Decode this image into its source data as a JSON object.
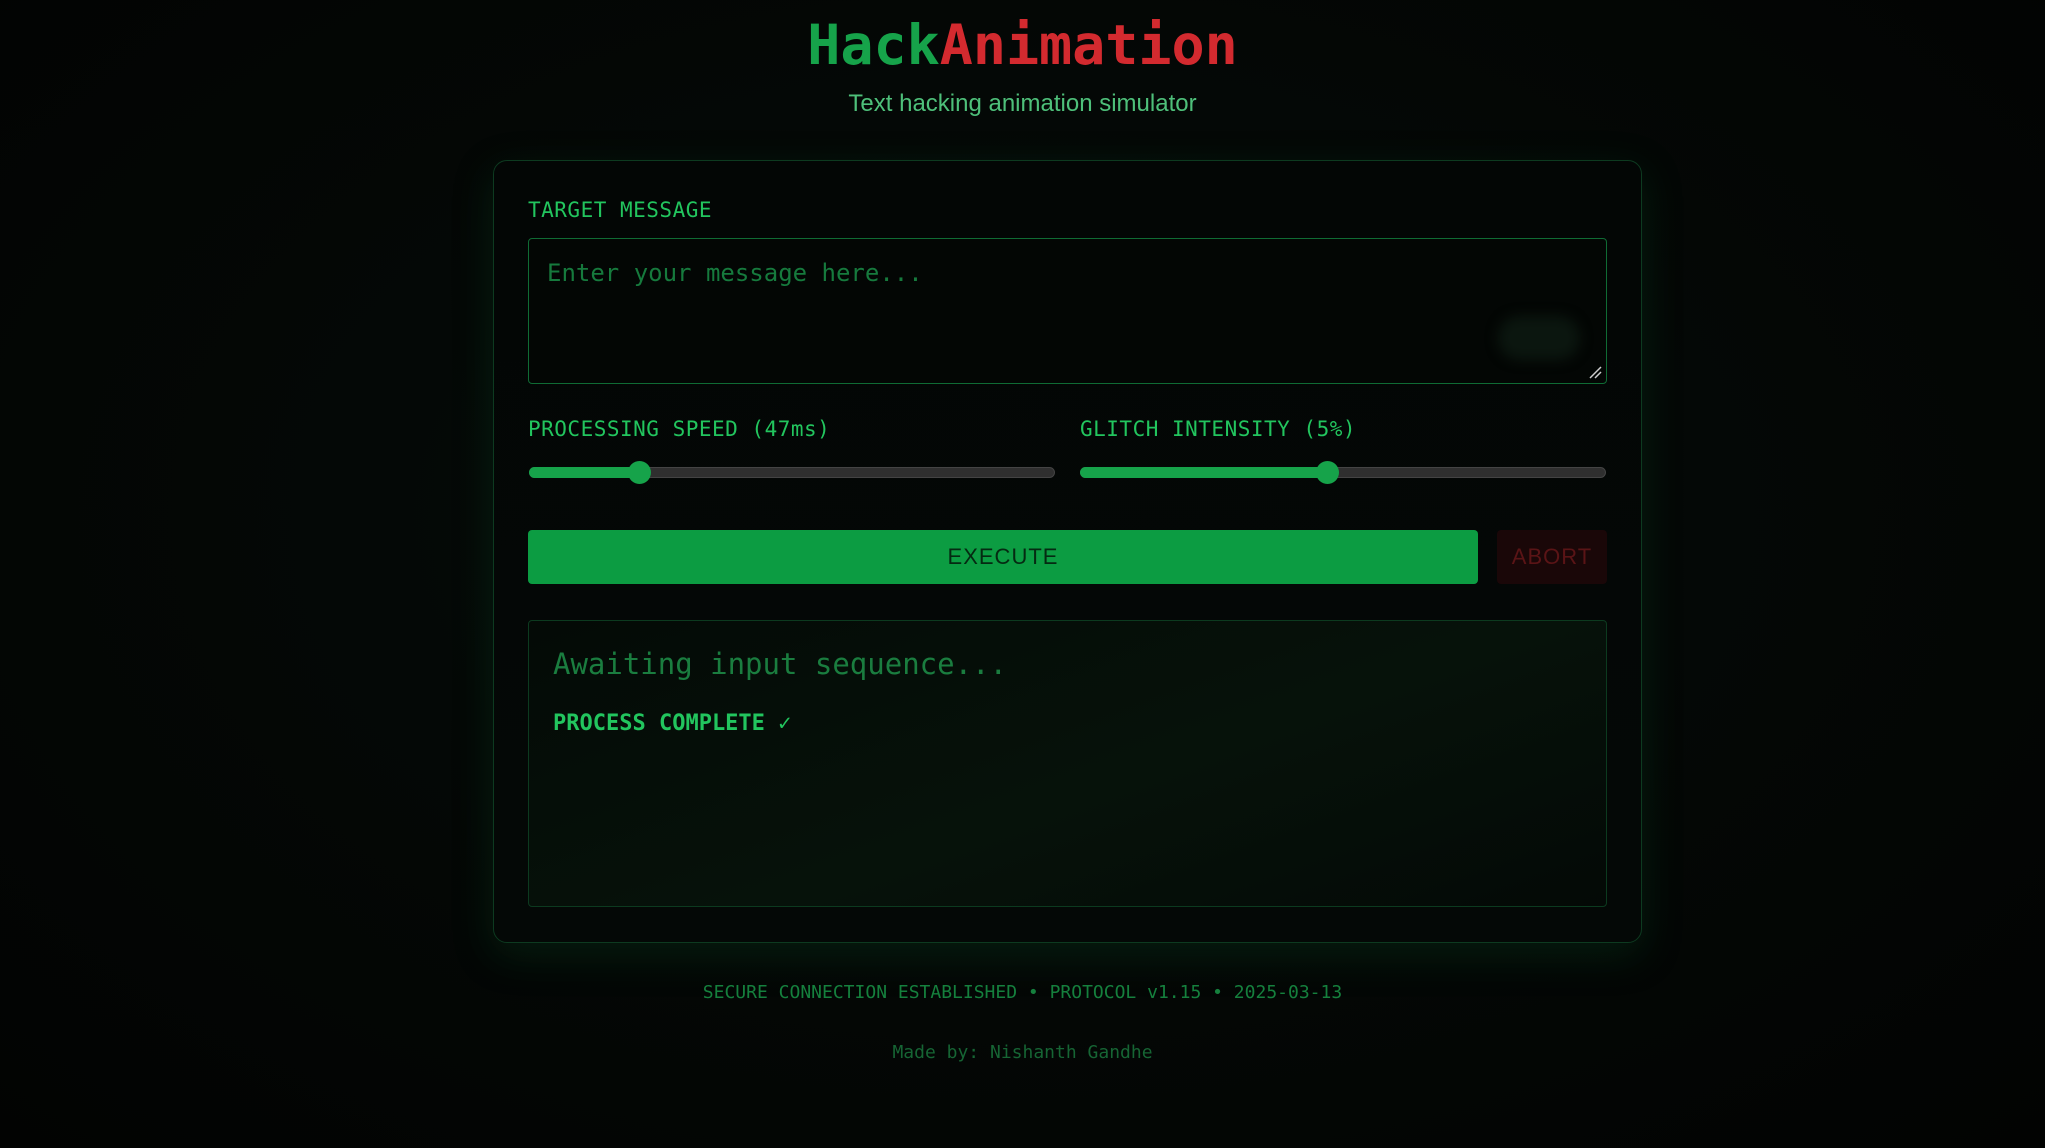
{
  "header": {
    "title_part1": "Hack",
    "title_part2": "Animation",
    "subtitle": "Text hacking animation simulator"
  },
  "form": {
    "message_label": "TARGET MESSAGE",
    "message_placeholder": "Enter your message here...",
    "message_value": "",
    "speed_label": "PROCESSING SPEED (47ms)",
    "speed_value_ms": 47,
    "speed_fraction": 0.21,
    "glitch_label": "GLITCH INTENSITY (5%)",
    "glitch_value_percent": 5,
    "glitch_fraction": 0.47,
    "execute_label": "EXECUTE",
    "abort_label": "ABORT"
  },
  "output": {
    "status_text": "Awaiting input sequence...",
    "complete_text": "PROCESS COMPLETE ✓"
  },
  "footer": {
    "status_line": "SECURE CONNECTION ESTABLISHED • PROTOCOL v1.15 • 2025-03-13",
    "credit": "Made by: Nishanth Gandhe"
  },
  "colors": {
    "primary_green": "#16a34a",
    "accent_red": "#d32a2f",
    "background": "#030504"
  }
}
